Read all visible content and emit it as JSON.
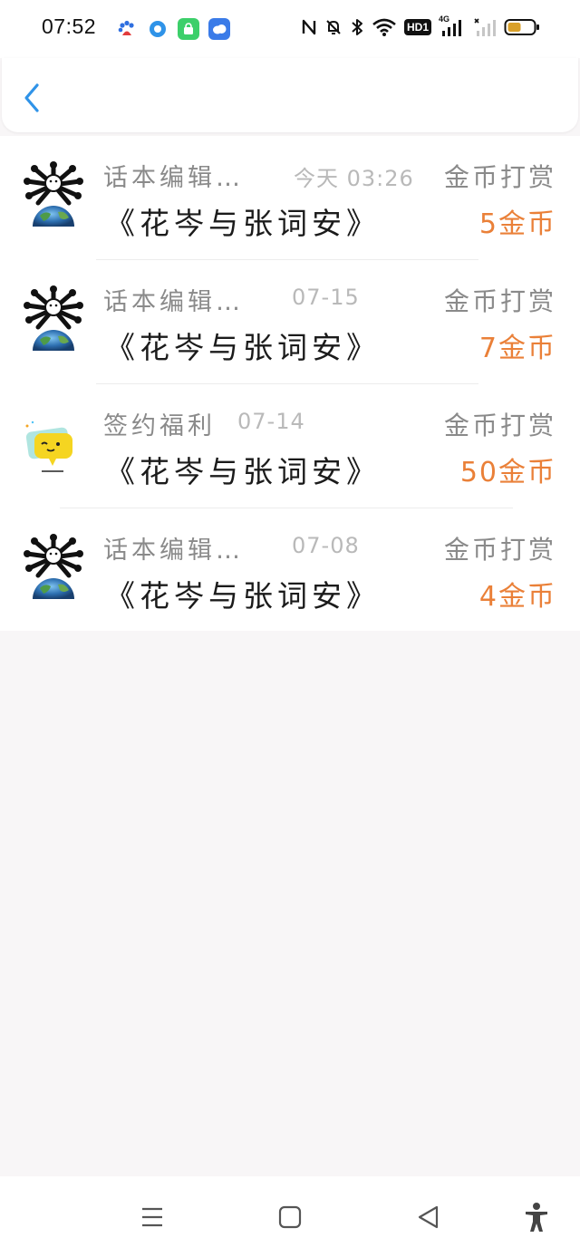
{
  "status_bar": {
    "time": "07:52",
    "app_icons": [
      "baidu-icon",
      "browser-icon",
      "store-icon",
      "cloud-icon"
    ],
    "system_icons": [
      "nfc-icon",
      "mute-bell-icon",
      "bluetooth-icon",
      "wifi-icon",
      "hd-badge-icon",
      "signal-4g-icon",
      "signal-empty-icon",
      "battery-icon"
    ],
    "hd_label": "HD1",
    "network_label": "4G"
  },
  "header": {
    "back_icon": "chevron-left-icon"
  },
  "records": [
    {
      "source": "话本编辑…",
      "date": "今天 03:26",
      "type": "金币打赏",
      "title": "《花岑与张词安》",
      "amount": "5金币",
      "avatar": "spiky-globe-avatar"
    },
    {
      "source": "话本编辑…",
      "date": "07-15",
      "type": "金币打赏",
      "title": "《花岑与张词安》",
      "amount": "7金币",
      "avatar": "spiky-globe-avatar"
    },
    {
      "source": "签约福利",
      "date": "07-14",
      "type": "金币打赏",
      "title": "《花岑与张词安》",
      "amount": "50金币",
      "avatar": "chat-bubble-avatar"
    },
    {
      "source": "话本编辑…",
      "date": "07-08",
      "type": "金币打赏",
      "title": "《花岑与张词安》",
      "amount": "4金币",
      "avatar": "spiky-globe-avatar"
    }
  ],
  "colors": {
    "accent": "#2f93e8",
    "coin": "#ea8038",
    "muted_text": "#8a8a8a",
    "date_text": "#b9b9b9",
    "background": "#f8f6f7"
  },
  "nav_bar": {
    "icons": [
      "menu-icon",
      "home-square-icon",
      "back-triangle-icon",
      "accessibility-icon"
    ]
  }
}
